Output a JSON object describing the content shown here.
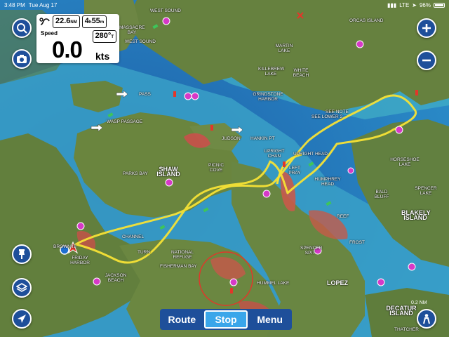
{
  "status_bar": {
    "time": "3:48 PM",
    "date": "Tue Aug 17",
    "network": "LTE",
    "battery": "96%",
    "battery_level": 0.96
  },
  "nav_panel": {
    "distance_value": "22.6",
    "distance_unit": "NM",
    "time_hours": "4",
    "time_unit": "h",
    "time_minutes": "55",
    "time_min_unit": "m",
    "speed_label": "Speed",
    "speed_value": "0.0",
    "speed_unit": "kts",
    "heading_value": "280°",
    "heading_unit": "T"
  },
  "buttons": {
    "search": "search-icon",
    "camera": "camera-icon",
    "zoom_in": "plus-icon",
    "zoom_out": "minus-icon",
    "pin": "pin-icon",
    "layers": "layers-icon",
    "locate": "navigation-arrow-icon",
    "person": "person-icon"
  },
  "bottom_bar": {
    "route": "Route",
    "stop": "Stop",
    "menu": "Menu"
  },
  "scale": {
    "label": "0.2",
    "unit": "NM"
  },
  "map_labels": {
    "west_sound": "WEST SOUND",
    "massacre_bay": "MASSACRE BAY",
    "west_sound_2": "WEST SOUND",
    "orcas_island": "ORCAS ISLAND",
    "martin_lake": "MARTIN LAKE",
    "killebrew_lake": "KILLEBREW LAKE",
    "white_beach": "WHITE BEACH",
    "grindstone_harbor": "GRINDSTONE HARBOR",
    "pass": "PASS",
    "wasp_passage": "WASP PASSAGE",
    "see_note": "SEE NOTE",
    "see_lower": "SEE LOWER 2",
    "hankin_pt": "HANKIN PT",
    "judson": "JUDSON",
    "upright_head": "UPRIGHT HEAD",
    "upright_chan": "UPRIGHT CHAN",
    "left_chan": "LEFT PRAY",
    "humphrey_head": "HUMPHREY HEAD",
    "horseshoe_lake": "HORSESHOE LAKE",
    "spencer_lake": "SPENCER LAKE",
    "bald_bluff": "BALD BLUFF",
    "blakely_island": "BLAKELY ISLAND",
    "parks_bay": "PARKS BAY",
    "shaw_island": "SHAW ISLAND",
    "picnic_cove": "PICNIC COVE",
    "reef": "REEF",
    "friday_harbor": "FRIDAY HARBOR",
    "channel": "CHANNEL",
    "turn": "TURN",
    "national_refuge": "NATIONAL REFUGE",
    "jackson_beach": "JACKSON BEACH",
    "spencer_spit": "SPENCER SPIT",
    "fisherman_bay": "FISHERMAN BAY",
    "hummel_lake": "HUMMEL LAKE",
    "lopez": "LOPEZ",
    "decatur_island": "DECATUR ISLAND",
    "brown_is": "BROWN IS",
    "thatcher": "THATCHER",
    "frost": "FROST"
  }
}
